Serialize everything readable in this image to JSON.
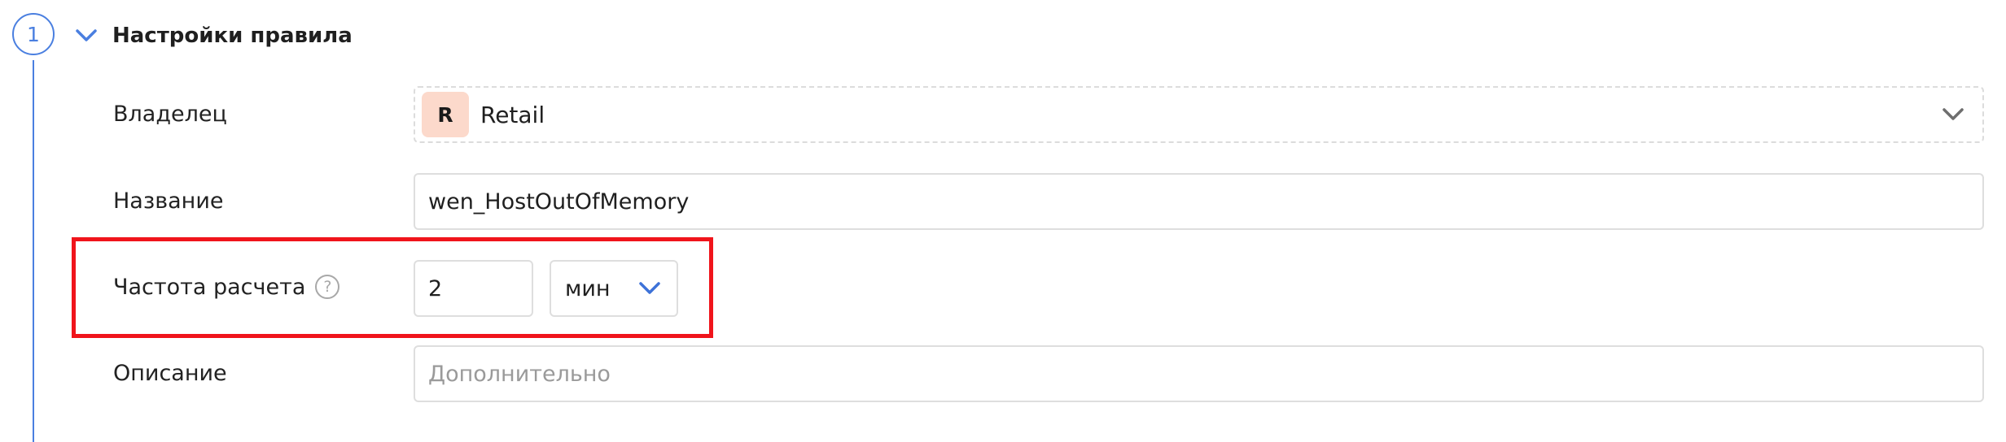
{
  "section": {
    "step_number": "1",
    "title": "Настройки правила"
  },
  "fields": {
    "owner": {
      "label": "Владелец",
      "badge": "R",
      "value": "Retail"
    },
    "name": {
      "label": "Название",
      "value": "wen_HostOutOfMemory"
    },
    "frequency": {
      "label": "Частота расчета",
      "help": "?",
      "value": "2",
      "unit": "мин"
    },
    "description": {
      "label": "Описание",
      "placeholder": "Дополнительно",
      "value": ""
    }
  },
  "colors": {
    "accent": "#4a7fe0",
    "highlight": "#f0141b",
    "owner_badge_bg": "#fcd9cb"
  },
  "icons": {
    "section_toggle": "chevron-down-icon",
    "owner_dropdown": "chevron-down-icon",
    "unit_dropdown": "chevron-down-icon",
    "help": "question-circle-icon"
  }
}
